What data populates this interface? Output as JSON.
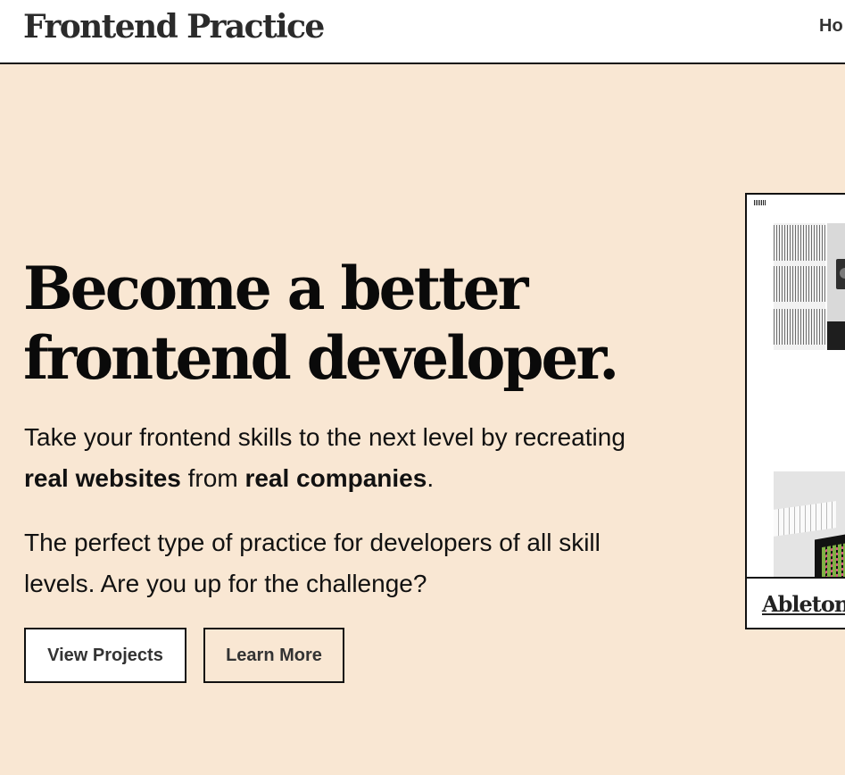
{
  "header": {
    "logo_text": "Frontend Practice",
    "nav_item": "Ho"
  },
  "hero": {
    "title_line1": "Become a better",
    "title_line2": "frontend developer.",
    "para1": {
      "t1": "Take your frontend skills to the next level by recreating ",
      "b1": "real websites",
      "t2": " from ",
      "b2": "real companies",
      "t3": "."
    },
    "para2": "The perfect type of practice for developers of all skill levels. Are you up for the challenge?",
    "buttons": {
      "view_projects": "View Projects",
      "learn_more": "Learn More"
    }
  },
  "project_card": {
    "label": "Ableton"
  },
  "colors": {
    "background": "#f9e7d3",
    "text": "#111111",
    "header_bg": "#ffffff"
  }
}
